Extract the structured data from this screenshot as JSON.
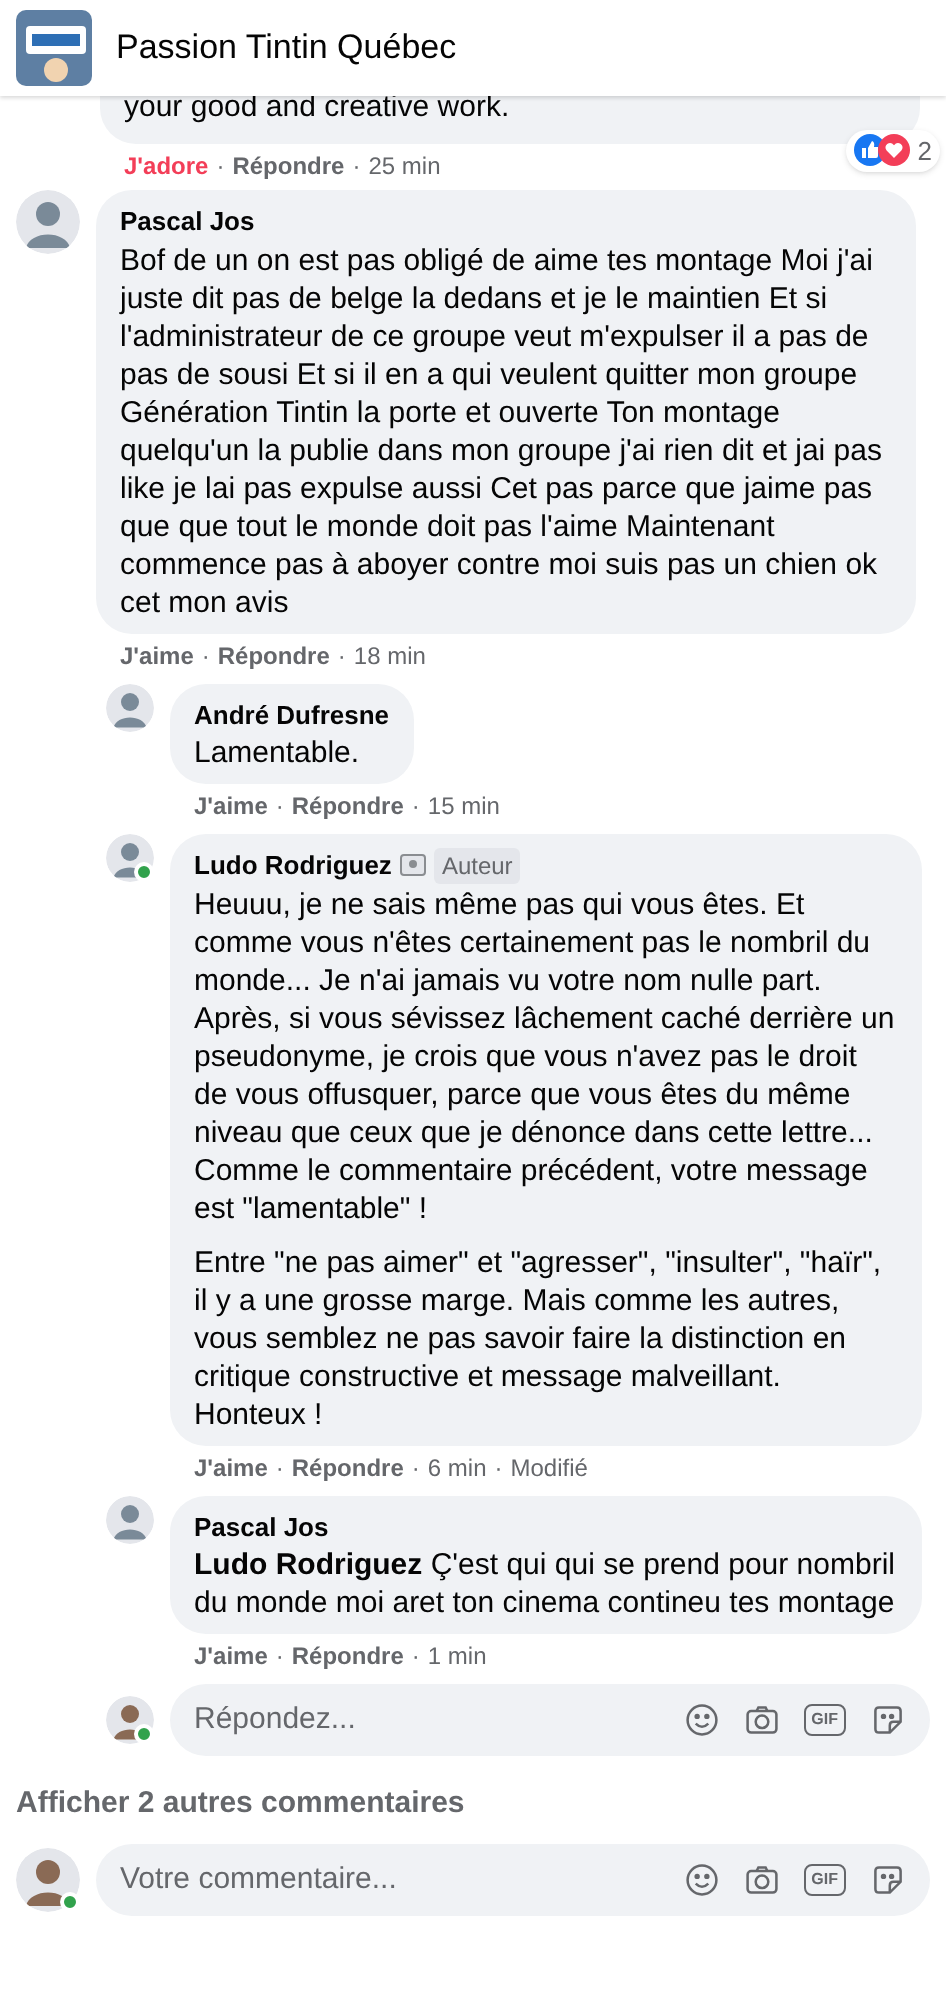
{
  "header": {
    "title": "Passion Tintin Québec"
  },
  "cut_comment": {
    "text": "your good and creative work.",
    "actions": {
      "like": "J'adore",
      "like_active": true,
      "separator": "·",
      "reply": "Répondre",
      "time": "25 min"
    },
    "reactions": {
      "count": "2"
    }
  },
  "comments": [
    {
      "author": "Pascal Jos",
      "online": false,
      "text": [
        "Bof de un on est pas obligé de aime tes montage Moi j'ai juste dit pas de belge la dedans et je le maintien Et si l'administrateur de ce groupe veut m'expulser il a pas de pas de sousi Et si il en a qui veulent quitter mon groupe Génération Tintin la porte et ouverte Ton montage quelqu'un la publie dans mon groupe j'ai rien dit et jai pas like je lai pas expulse aussi Cet pas parce que jaime pas que que tout le monde doit pas l'aime Maintenant commence pas à aboyer contre moi suis pas un chien ok cet mon avis"
      ],
      "actions": {
        "like": "J'aime",
        "like_active": false,
        "separator": "·",
        "reply": "Répondre",
        "time": "18 min"
      },
      "replies": [
        {
          "author": "André Dufresne",
          "online": false,
          "text": [
            "Lamentable."
          ],
          "actions": {
            "like": "J'aime",
            "like_active": false,
            "separator": "·",
            "reply": "Répondre",
            "time": "15 min"
          }
        },
        {
          "author": "Ludo Rodriguez",
          "badge": "Auteur",
          "online": true,
          "text": [
            "Heuuu, je ne sais même pas qui vous êtes. Et comme vous n'êtes certainement pas le nombril du monde... Je n'ai jamais vu votre nom nulle part. Après, si vous sévissez lâchement caché derrière un pseudonyme, je crois que vous n'avez pas le droit de vous offusquer, parce que vous êtes du même niveau que ceux que je dénonce dans cette lettre... Comme le commentaire précédent, votre message est \"lamentable\" !",
            "Entre \"ne pas aimer\" et \"agresser\", \"insulter\", \"haïr\", il y a une grosse marge. Mais comme les autres, vous semblez ne pas savoir faire la distinction en critique constructive et message malveillant. Honteux !"
          ],
          "actions": {
            "like": "J'aime",
            "like_active": false,
            "separator": "·",
            "reply": "Répondre",
            "time": "6 min",
            "edited": "Modifié"
          }
        },
        {
          "author": "Pascal Jos",
          "online": false,
          "text": [
            "**Ludo Rodriguez** Ç'est qui qui se prend pour nombril du monde moi aret ton cinema contineu tes montage"
          ],
          "actions": {
            "like": "J'aime",
            "like_active": false,
            "separator": "·",
            "reply": "Répondre",
            "time": "1 min"
          }
        }
      ],
      "reply_field": {
        "placeholder": "Répondez...",
        "online": true,
        "gif": "GIF"
      }
    }
  ],
  "more_comments": "Afficher 2 autres commentaires",
  "comment_field": {
    "placeholder": "Votre commentaire...",
    "online": true,
    "gif": "GIF"
  }
}
